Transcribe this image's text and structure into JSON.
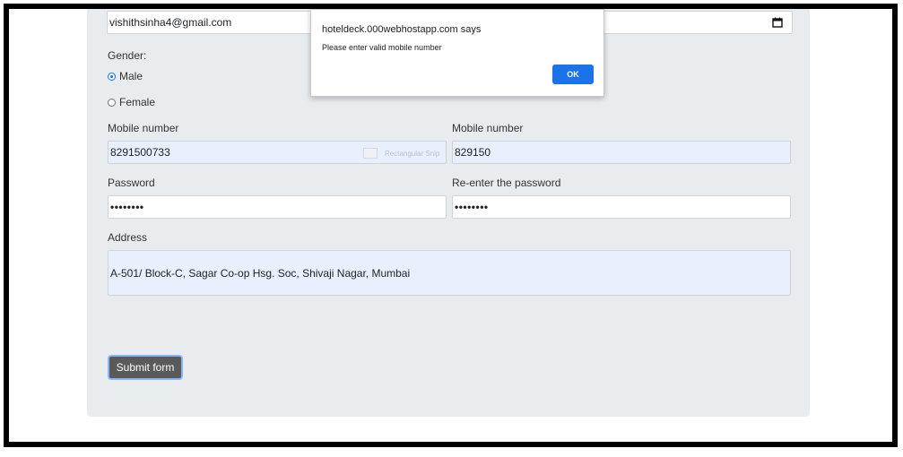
{
  "form": {
    "email_value": "vishithsinha4@gmail.com",
    "gender_label": "Gender:",
    "gender_options": [
      {
        "label": "Male",
        "checked": true
      },
      {
        "label": "Female",
        "checked": false
      }
    ],
    "mobile_label_1": "Mobile number",
    "mobile_value_1": "8291500733",
    "mobile_label_2": "Mobile number",
    "mobile_value_2": "829150",
    "password_label": "Password",
    "password_value": "••••••••",
    "reenter_label": "Re-enter the password",
    "reenter_value": "••••••••",
    "address_label": "Address",
    "address_value": "A-501/ Block-C, Sagar Co-op Hsg. Soc, Shivaji Nagar, Mumbai",
    "submit_label": "Submit form",
    "ghost_hint": "Rectangular Snip"
  },
  "dialog": {
    "title": "hoteldeck.000webhostapp.com says",
    "message": "Please enter valid mobile number",
    "ok_label": "OK"
  },
  "icons": {
    "calendar": "calendar-icon"
  },
  "colors": {
    "panel_bg": "#e9ecef",
    "autofill_bg": "#e8f0fe",
    "primary_blue": "#1a73e8",
    "submit_bg": "#5a5a5a"
  }
}
